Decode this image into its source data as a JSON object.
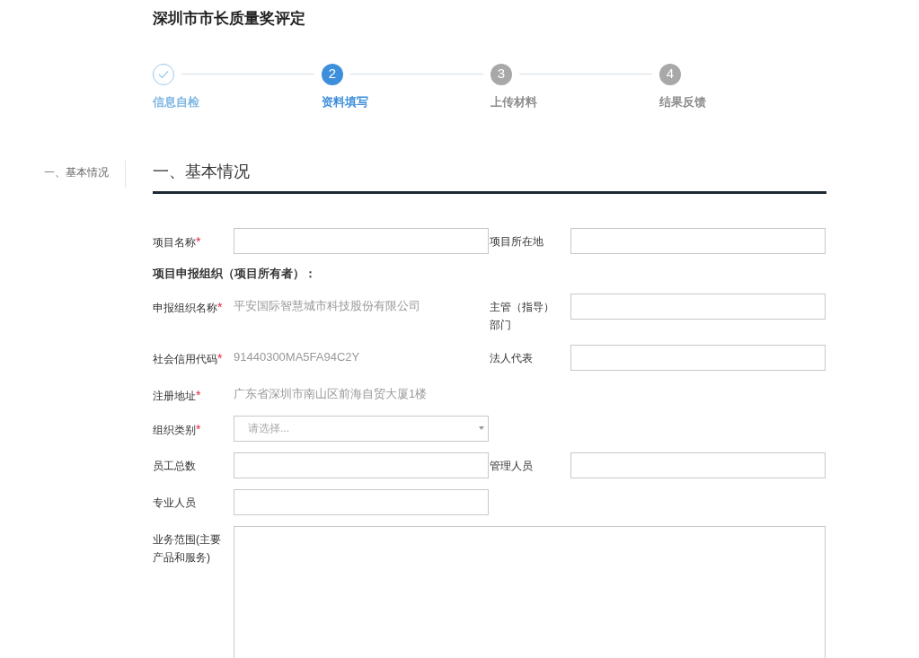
{
  "title": "深圳市市长质量奖评定",
  "steps": [
    {
      "label": "信息自检",
      "done": true,
      "selected": false
    },
    {
      "label": "资料填写",
      "number": "2",
      "done": false,
      "selected": true
    },
    {
      "label": "上传材料",
      "number": "3",
      "done": false,
      "selected": false
    },
    {
      "label": "结果反馈",
      "number": "4",
      "done": false,
      "selected": false
    }
  ],
  "side_nav": [
    {
      "label": "一、基本情况",
      "selected": true
    }
  ],
  "section_title": "一、基本情况",
  "rows": [
    [
      {
        "kind": "input",
        "label": "项目名称",
        "required_mark": "*"
      },
      {
        "kind": "input",
        "label": "项目所在地"
      }
    ],
    [
      {
        "kind": "heading",
        "label": "项目申报组织（项目所有者）："
      }
    ],
    [
      {
        "kind": "text",
        "label": "申报组织名称",
        "required_mark": "*",
        "value": "平安国际智慧城市科技股份有限公司"
      },
      {
        "kind": "input",
        "label": "主管（指导）部门"
      }
    ],
    [
      {
        "kind": "text",
        "label": "社会信用代码",
        "required_mark": "*",
        "value": "91440300MA5FA94C2Y"
      },
      {
        "kind": "input",
        "label": "法人代表"
      }
    ],
    [
      {
        "kind": "text",
        "label": "注册地址",
        "required_mark": "*",
        "value": "广东省深圳市南山区前海自贸大厦1楼"
      }
    ],
    [
      {
        "kind": "select",
        "label": "组织类别",
        "required_mark": "*",
        "placeholder": "请选择..."
      }
    ],
    [
      {
        "kind": "input",
        "label": "员工总数"
      },
      {
        "kind": "input",
        "label": "管理人员"
      }
    ],
    [
      {
        "kind": "input",
        "label": "专业人员"
      }
    ],
    [
      {
        "kind": "textarea",
        "label": "业务范围(主要产品和服务)"
      }
    ]
  ]
}
